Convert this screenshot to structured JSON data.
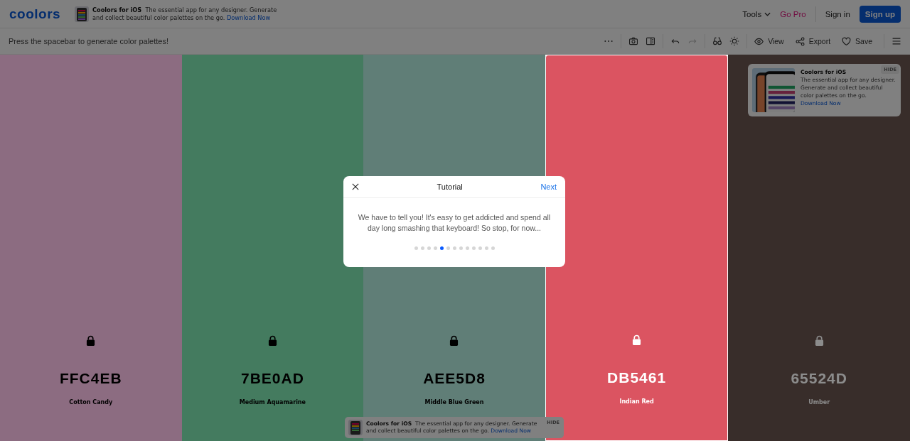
{
  "header": {
    "logo": "coolors",
    "ad": {
      "title": "Coolors for iOS",
      "text": "The essential app for any designer. Generate and collect beautiful color palettes on the go.",
      "link": "Download Now"
    },
    "nav": [
      {
        "label": "Tools",
        "kind": "dropdown"
      },
      {
        "label": "Go Pro",
        "kind": "pro"
      },
      {
        "label": "Sign in",
        "kind": "link"
      },
      {
        "label": "Sign up",
        "kind": "primary"
      }
    ]
  },
  "toolbar": {
    "hint": "Press the spacebar to generate color palettes!",
    "icon_buttons": [
      {
        "kind": "more",
        "disabled": false
      },
      {
        "kind": "camera",
        "disabled": false
      },
      {
        "kind": "panel",
        "disabled": false
      },
      {
        "kind": "undo",
        "disabled": false
      },
      {
        "kind": "redo",
        "disabled": true
      },
      {
        "kind": "glasses",
        "disabled": false
      },
      {
        "kind": "sun",
        "disabled": false
      }
    ],
    "actions": [
      {
        "label": "View",
        "kind": "view"
      },
      {
        "label": "Export",
        "kind": "export"
      },
      {
        "label": "Save",
        "kind": "save"
      }
    ]
  },
  "palette": [
    {
      "hex": "FFC4EB",
      "name": "Cotton Candy",
      "highlighted": false
    },
    {
      "hex": "7BE0AD",
      "name": "Medium Aquamarine",
      "highlighted": false
    },
    {
      "hex": "AEE5D8",
      "name": "Middle Blue Green",
      "highlighted": false
    },
    {
      "hex": "DB5461",
      "name": "Indian Red",
      "highlighted": true
    },
    {
      "hex": "65524D",
      "name": "Umber",
      "highlighted": false
    }
  ],
  "side_ad": {
    "title": "Coolors for iOS",
    "text": "The essential app for any designer. Generate and collect beautiful color palettes on the go.",
    "link": "Download Now",
    "hide": "HIDE"
  },
  "bottom_ad": {
    "title": "Coolors for iOS",
    "text": "The essential app for any designer. Generate and collect beautiful color palettes on the go.",
    "link": "Download Now",
    "hide": "HIDE"
  },
  "tutorial": {
    "title": "Tutorial",
    "next": "Next",
    "text": "We have to tell you! It's easy to get addicted and spend all day long smashing that keyboard! So stop, for now...",
    "steps": [
      {
        "selected": false
      },
      {
        "selected": false
      },
      {
        "selected": false
      },
      {
        "selected": false
      },
      {
        "selected": true
      },
      {
        "selected": false
      },
      {
        "selected": false
      },
      {
        "selected": false
      },
      {
        "selected": false
      },
      {
        "selected": false
      },
      {
        "selected": false
      },
      {
        "selected": false
      },
      {
        "selected": false
      }
    ]
  }
}
